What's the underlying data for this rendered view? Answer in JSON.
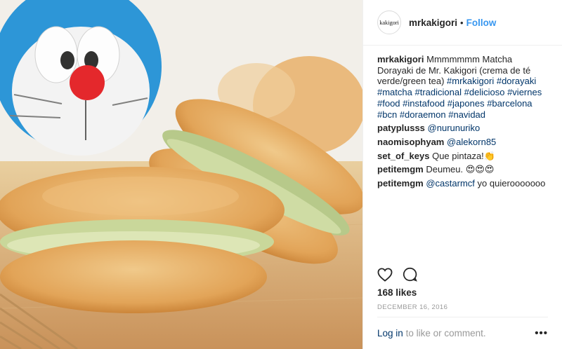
{
  "header": {
    "avatar_text": "kakigori",
    "username": "mrkakigori",
    "separator": "•",
    "follow_label": "Follow"
  },
  "caption": {
    "user": "mrkakigori",
    "text": "Mmmmmmm Matcha Dorayaki de Mr. Kakigori (crema de té verde/green tea)",
    "hashtags": [
      "#mrkakigori",
      "#dorayaki",
      "#matcha",
      "#tradicional",
      "#delicioso",
      "#viernes",
      "#food",
      "#instafood",
      "#japones",
      "#barcelona",
      "#bcn",
      "#doraemon",
      "#navidad"
    ]
  },
  "comments": [
    {
      "user": "patyplusss",
      "mention": "@nurunuriko",
      "text": ""
    },
    {
      "user": "naomisophyam",
      "mention": "@alekorn85",
      "text": ""
    },
    {
      "user": "set_of_keys",
      "mention": "",
      "text": "Que pintaza!👏"
    },
    {
      "user": "petitemgm",
      "mention": "",
      "text": "Deumeu. 😍😍😍"
    },
    {
      "user": "petitemgm",
      "mention": "@castarmcf",
      "text": "yo quierooooooo"
    }
  ],
  "actions": {
    "like_icon": "heart-icon",
    "comment_icon": "comment-bubble-icon"
  },
  "likes": "168 likes",
  "date": "DECEMBER 16, 2016",
  "footer": {
    "login_label": "Log in",
    "login_rest": "to like or comment.",
    "more_label": "•••"
  },
  "colors": {
    "link": "#003569",
    "follow": "#3897f0",
    "muted": "#999999",
    "text": "#262626"
  }
}
